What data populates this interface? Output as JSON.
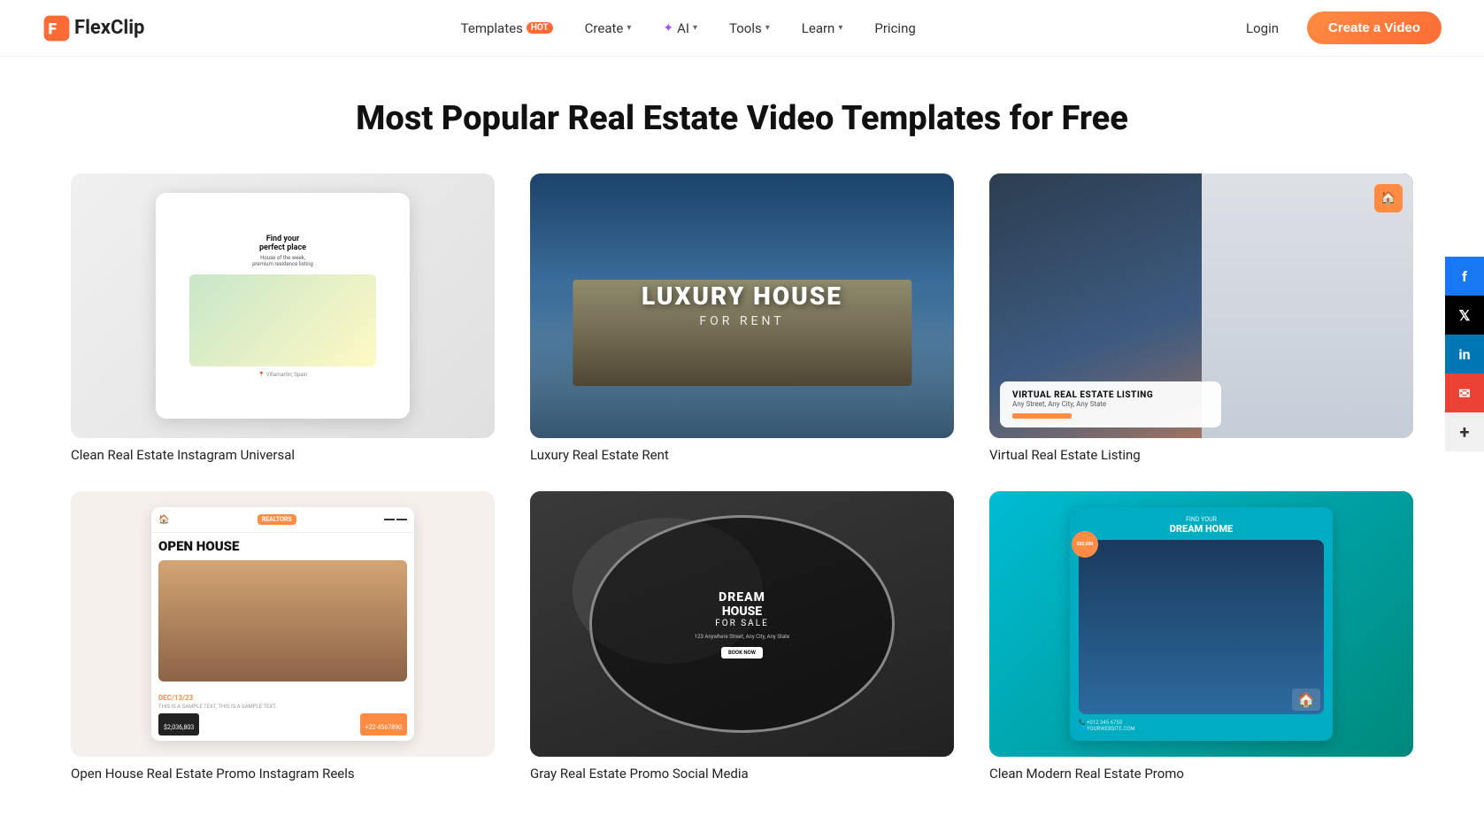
{
  "logo": {
    "text": "FlexClip"
  },
  "nav": {
    "templates_label": "Templates",
    "templates_badge": "HOT",
    "create_label": "Create",
    "ai_label": "AI",
    "tools_label": "Tools",
    "learn_label": "Learn",
    "pricing_label": "Pricing",
    "login_label": "Login",
    "create_video_label": "Create a Video"
  },
  "page": {
    "title": "Most Popular Real Estate Video Templates for Free"
  },
  "templates": [
    {
      "id": 1,
      "label": "Clean Real Estate Instagram Universal",
      "thumb_type": "1"
    },
    {
      "id": 2,
      "label": "Luxury Real Estate Rent",
      "thumb_type": "2",
      "text1": "LUXURY HOUSE",
      "text2": "FOR RENT"
    },
    {
      "id": 3,
      "label": "Virtual Real Estate Listing",
      "thumb_type": "3",
      "text1": "VIRTUAL REAL ESTATE LISTING",
      "text2": "Any Street, Any City, Any State"
    },
    {
      "id": 4,
      "label": "Open House Real Estate Promo Instagram Reels",
      "thumb_type": "4",
      "text1": "OPEN HOUSE",
      "date": "DEC/13/23",
      "price": "$2,036,803"
    },
    {
      "id": 5,
      "label": "Gray Real Estate Promo Social Media",
      "thumb_type": "5",
      "text1": "DREAM",
      "text2": "HOUSE",
      "text3": "FOR SALE",
      "text4": "123 Anywhere Street, Any City, Any State",
      "text5": "BOOK NOW"
    },
    {
      "id": 6,
      "label": "Clean Modern Real Estate Promo",
      "thumb_type": "6",
      "text1": "FIND YOUR",
      "text2": "DREAM HOME",
      "price": "$85,000"
    }
  ],
  "social": {
    "facebook": "f",
    "twitter": "𝕏",
    "linkedin": "in",
    "email": "✉",
    "more": "+"
  }
}
